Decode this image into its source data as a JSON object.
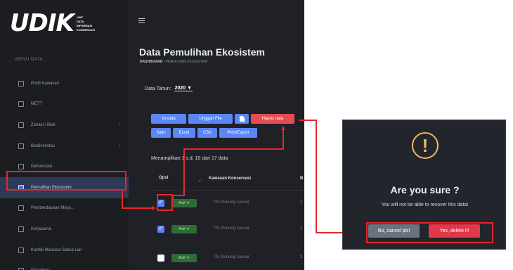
{
  "app": {
    "logo": {
      "word": "UDIK",
      "sub_lines": [
        "UNIT",
        "DATA",
        "INFORMASI",
        "KONSERVASI"
      ]
    },
    "sidebar": {
      "header": "MENU DATA",
      "items": [
        {
          "label": "Profil Kawasan",
          "icon": "grid-icon",
          "chevron": ""
        },
        {
          "label": "METT",
          "icon": "grid-icon",
          "chevron": ""
        },
        {
          "label": "Zonasi / Blok",
          "icon": "grid-icon",
          "chevron": "›"
        },
        {
          "label": "Biodiversitas",
          "icon": "grid-icon",
          "chevron": "›"
        },
        {
          "label": "Deforestasi",
          "icon": "grid-icon",
          "chevron": ""
        },
        {
          "label": "Pemulihan Ekosistem",
          "icon": "grid-icon",
          "chevron": "",
          "active": true
        },
        {
          "label": "Pemberdayaan Masy...",
          "icon": "grid-icon",
          "chevron": ""
        },
        {
          "label": "Kerjasama",
          "icon": "grid-icon",
          "chevron": ""
        },
        {
          "label": "Konflik Manusia Satwa Liar",
          "icon": "grid-icon",
          "chevron": ""
        },
        {
          "label": "Penelitian",
          "icon": "grid-icon",
          "chevron": ""
        }
      ]
    },
    "page": {
      "title": "Data Pemulihan Ekosistem",
      "breadcrumb_home": "DASHBOARD",
      "breadcrumb_sep": "/",
      "breadcrumb_current": "PEMULIHAN EKOSISTEM"
    },
    "filter": {
      "label": "Data Tahun:",
      "value": "2020 ▼"
    },
    "toolbar": {
      "add": "Isi data",
      "upload": "Unggah File",
      "doc_icon": "document-icon",
      "delete": "Hapus data",
      "copy": "Salin",
      "excel": "Excel",
      "csv": "CSV",
      "print": "Print/Export"
    },
    "table": {
      "info": "Menampilkan 1 s.d. 10 dari 17 data",
      "col_opsi": "Opsi",
      "col_sort": "↓↑",
      "col_kawasan": "Kawasan Konservasi",
      "col_more": "B",
      "rows": [
        {
          "checked": true,
          "status": "Aktif ▼",
          "kawasan": "TN Gunung Leuser",
          "more": "2"
        },
        {
          "checked": true,
          "status": "Aktif ▼",
          "kawasan": "TN Gunung Leuser",
          "more": "2"
        },
        {
          "checked": false,
          "status": "Aktif ▼",
          "kawasan": "TN Gunung Leuser",
          "more": "2"
        }
      ]
    }
  },
  "dialog": {
    "icon": "warning-icon",
    "icon_glyph": "!",
    "title": "Are you sure ?",
    "text": "You will not be able to recover this data!",
    "cancel": "No, cancel pls!",
    "confirm": "Yes, delete it!"
  },
  "colors": {
    "highlight": "#e5262c",
    "primary": "#5b86f7",
    "danger": "#e44d52",
    "warning": "#f0b85a"
  }
}
